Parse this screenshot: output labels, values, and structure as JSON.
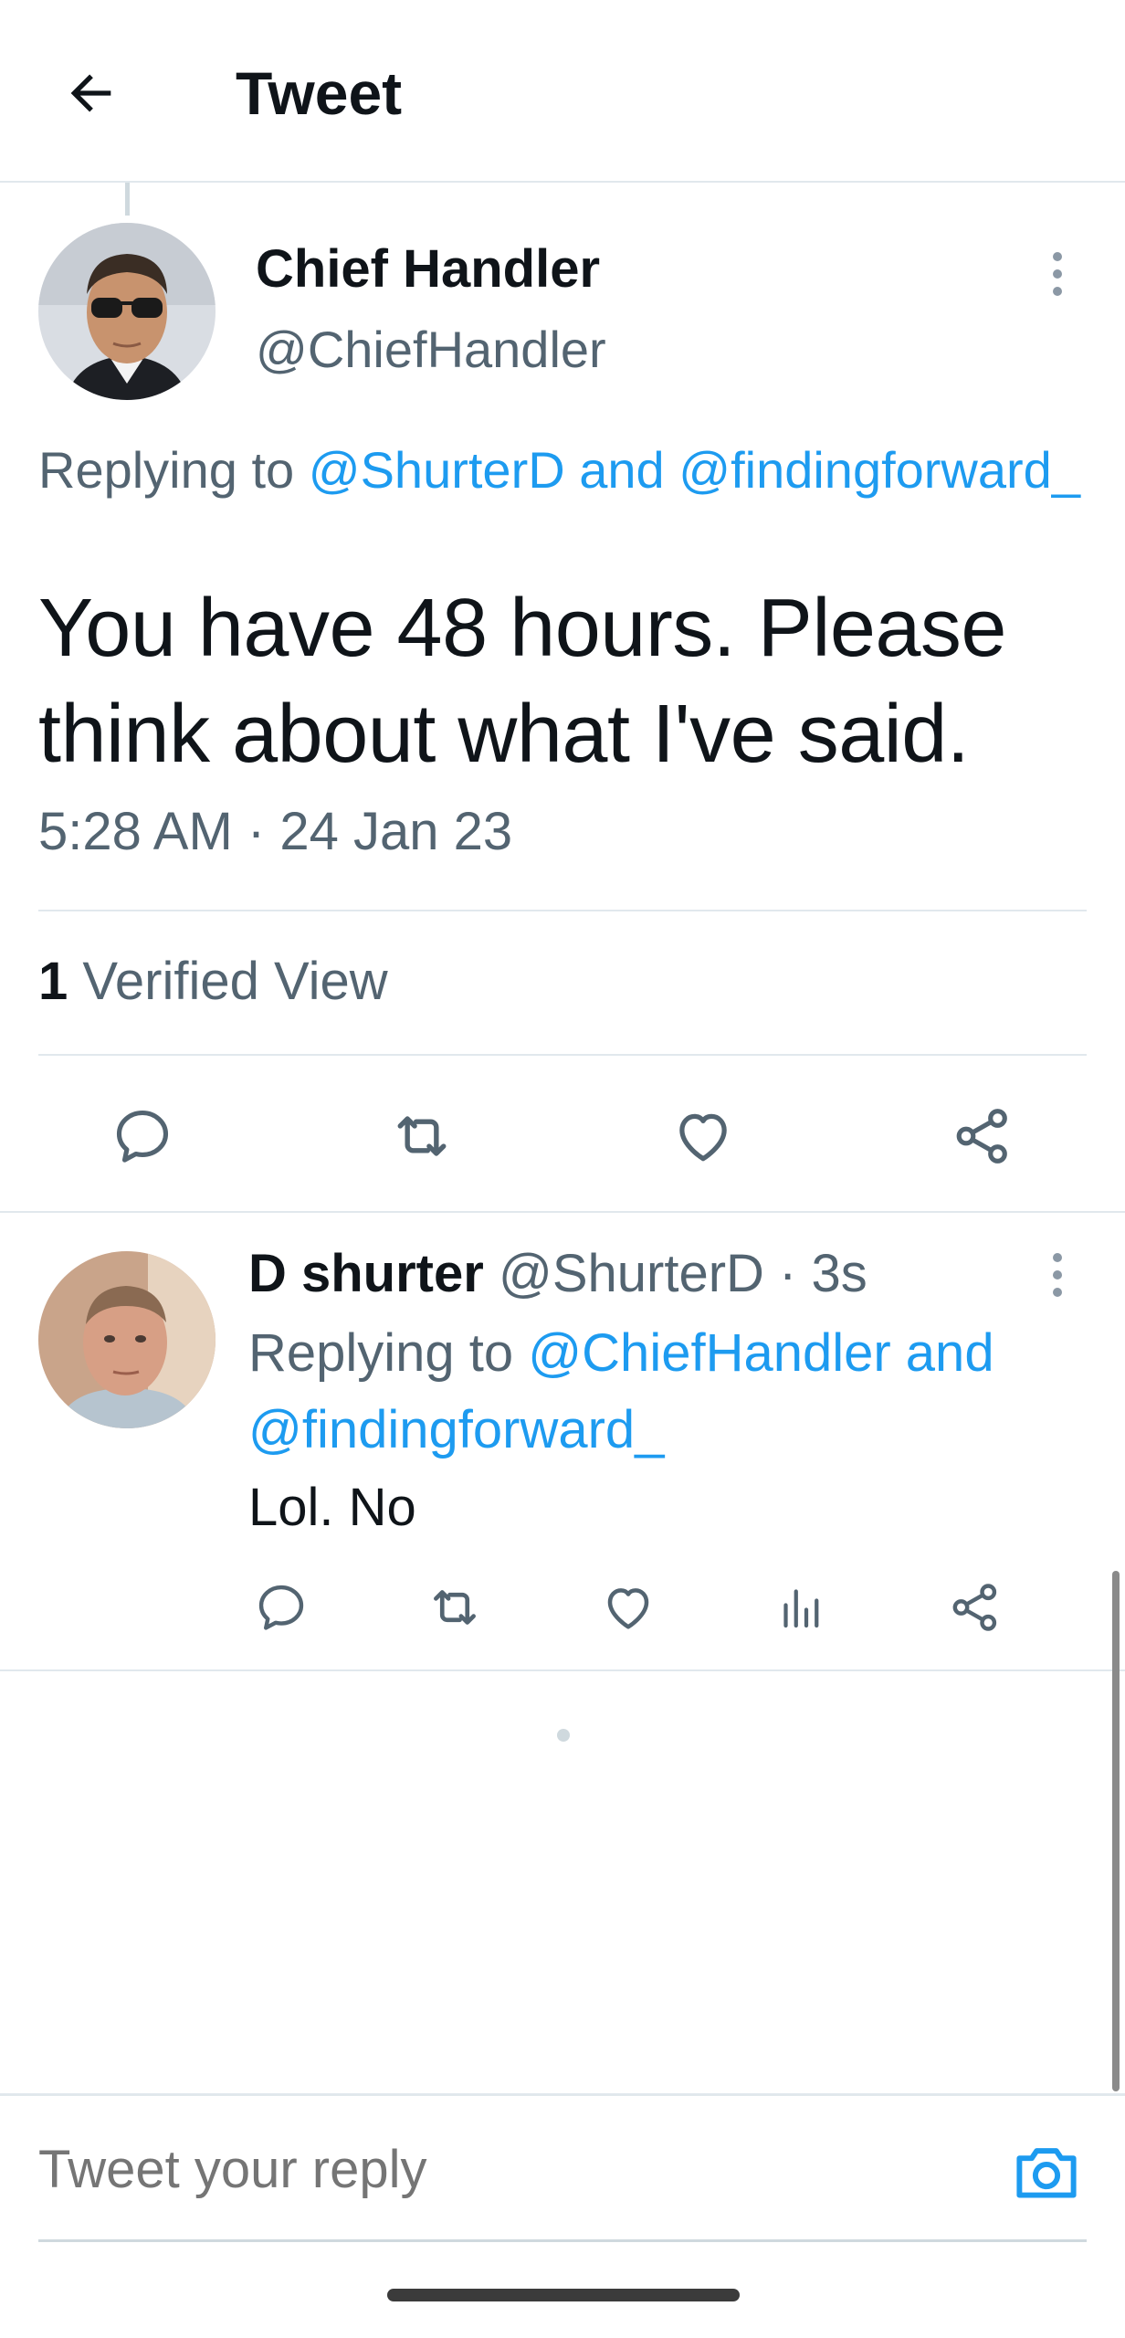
{
  "header": {
    "title": "Tweet",
    "back_icon": "arrow-left-icon"
  },
  "main_tweet": {
    "author_name": "Chief Handler",
    "author_handle": "@ChiefHandler",
    "replying_prefix": "Replying to ",
    "replying_users": "@ShurterD and @findingforward_",
    "text": "You have 48 hours. Please think about what I've said.",
    "timestamp": "5:28 AM · 24 Jan 23",
    "views_count": "1",
    "views_label": "Verified View",
    "actions": [
      "reply-icon",
      "retweet-icon",
      "like-icon",
      "share-icon"
    ]
  },
  "reply_tweet": {
    "author_name": "D shurter",
    "author_handle": "@ShurterD",
    "time_ago": "· 3s",
    "replying_prefix": "Replying to ",
    "replying_users": "@ChiefHandler and @findingforward_",
    "text": "Lol. No",
    "actions": [
      "reply-icon",
      "retweet-icon",
      "like-icon",
      "analytics-icon",
      "share-icon"
    ]
  },
  "compose": {
    "placeholder": "Tweet your reply",
    "camera_icon": "camera-icon"
  },
  "colors": {
    "accent": "#1d9bf0",
    "secondary_text": "#536471",
    "divider": "#e1e8ed"
  }
}
